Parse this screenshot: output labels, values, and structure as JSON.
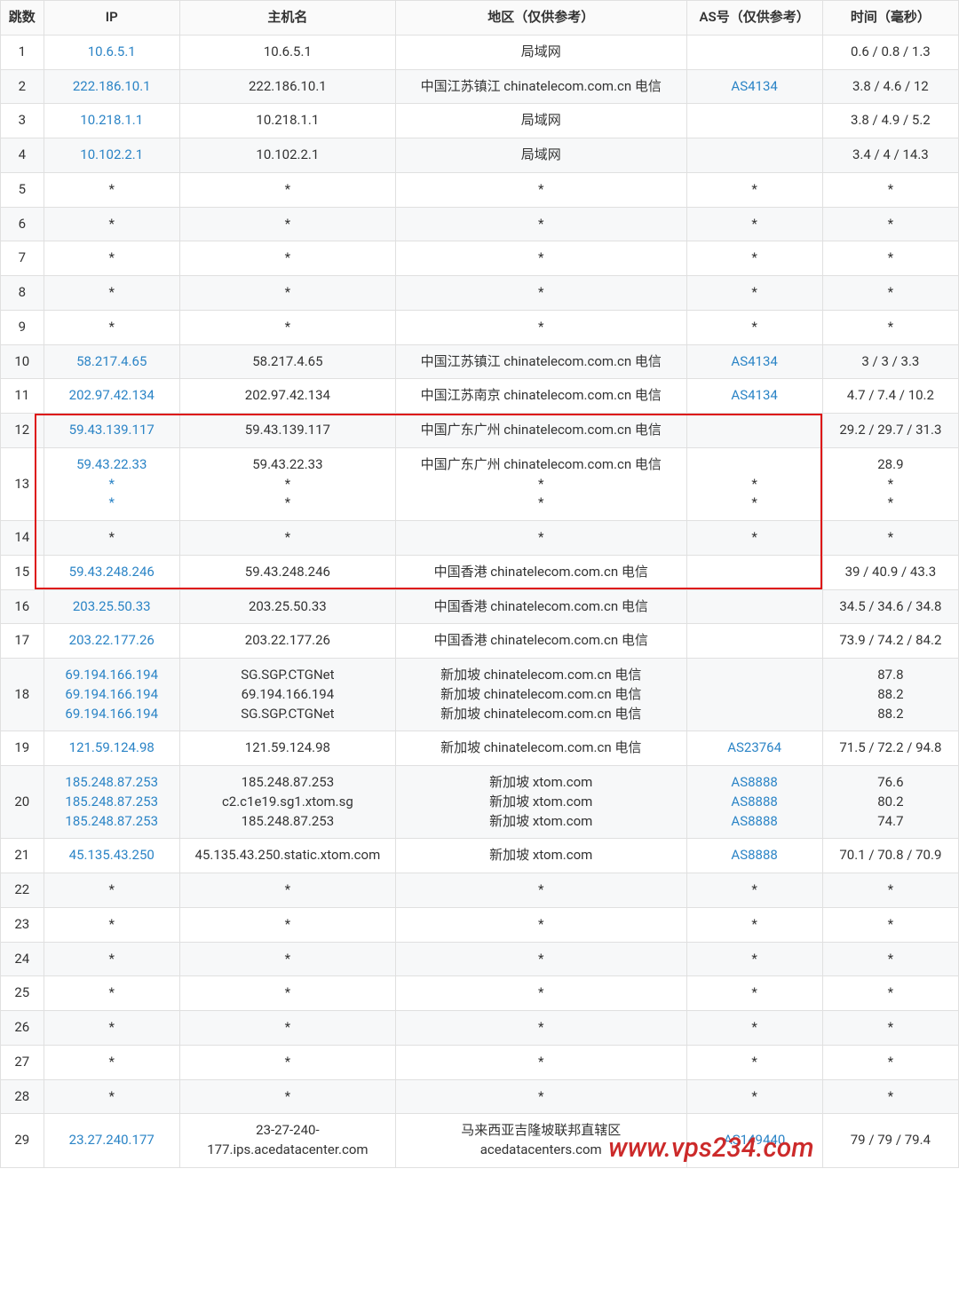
{
  "headers": {
    "hop": "跳数",
    "ip": "IP",
    "host": "主机名",
    "region": "地区（仅供参考）",
    "asn": "AS号（仅供参考）",
    "time": "时间（毫秒）"
  },
  "rows": [
    {
      "hop": "1",
      "ip": "10.6.5.1",
      "ip_link": true,
      "host": "10.6.5.1",
      "region": "局域网",
      "asn": "",
      "time": "0.6 / 0.8 / 1.3"
    },
    {
      "hop": "2",
      "ip": "222.186.10.1",
      "ip_link": true,
      "host": "222.186.10.1",
      "region": "中国江苏镇江 chinatelecom.com.cn 电信",
      "asn": "AS4134",
      "asn_link": true,
      "time": "3.8 / 4.6 / 12"
    },
    {
      "hop": "3",
      "ip": "10.218.1.1",
      "ip_link": true,
      "host": "10.218.1.1",
      "region": "局域网",
      "asn": "",
      "time": "3.8 / 4.9 / 5.2"
    },
    {
      "hop": "4",
      "ip": "10.102.2.1",
      "ip_link": true,
      "host": "10.102.2.1",
      "region": "局域网",
      "asn": "",
      "time": "3.4 / 4 / 14.3"
    },
    {
      "hop": "5",
      "ip": "*",
      "host": "*",
      "region": "*",
      "asn": "*",
      "time": "*"
    },
    {
      "hop": "6",
      "ip": "*",
      "host": "*",
      "region": "*",
      "asn": "*",
      "time": "*"
    },
    {
      "hop": "7",
      "ip": "*",
      "host": "*",
      "region": "*",
      "asn": "*",
      "time": "*"
    },
    {
      "hop": "8",
      "ip": "*",
      "host": "*",
      "region": "*",
      "asn": "*",
      "time": "*"
    },
    {
      "hop": "9",
      "ip": "*",
      "host": "*",
      "region": "*",
      "asn": "*",
      "time": "*"
    },
    {
      "hop": "10",
      "ip": "58.217.4.65",
      "ip_link": true,
      "host": "58.217.4.65",
      "region": "中国江苏镇江 chinatelecom.com.cn 电信",
      "asn": "AS4134",
      "asn_link": true,
      "time": "3 / 3 / 3.3"
    },
    {
      "hop": "11",
      "ip": "202.97.42.134",
      "ip_link": true,
      "host": "202.97.42.134",
      "region": "中国江苏南京 chinatelecom.com.cn 电信",
      "asn": "AS4134",
      "asn_link": true,
      "time": "4.7 / 7.4 / 10.2"
    },
    {
      "hop": "12",
      "ip": "59.43.139.117",
      "ip_link": true,
      "host": "59.43.139.117",
      "region": "中国广东广州 chinatelecom.com.cn 电信",
      "asn": "",
      "time": "29.2 / 29.7 / 31.3"
    },
    {
      "hop": "13",
      "ip": "59.43.22.33\n*\n*",
      "ip_link": true,
      "host": "59.43.22.33\n*\n*",
      "region": "中国广东广州 chinatelecom.com.cn 电信\n*\n*",
      "asn": "\n*\n*",
      "time": "28.9\n*\n*"
    },
    {
      "hop": "14",
      "ip": "*",
      "host": "*",
      "region": "*",
      "asn": "*",
      "time": "*"
    },
    {
      "hop": "15",
      "ip": "59.43.248.246",
      "ip_link": true,
      "host": "59.43.248.246",
      "region": "中国香港 chinatelecom.com.cn 电信",
      "asn": "",
      "time": "39 / 40.9 / 43.3"
    },
    {
      "hop": "16",
      "ip": "203.25.50.33",
      "ip_link": true,
      "host": "203.25.50.33",
      "region": "中国香港 chinatelecom.com.cn 电信",
      "asn": "",
      "time": "34.5 / 34.6 / 34.8"
    },
    {
      "hop": "17",
      "ip": "203.22.177.26",
      "ip_link": true,
      "host": "203.22.177.26",
      "region": "中国香港 chinatelecom.com.cn 电信",
      "asn": "",
      "time": "73.9 / 74.2 / 84.2"
    },
    {
      "hop": "18",
      "ip": "69.194.166.194\n69.194.166.194\n69.194.166.194",
      "ip_link": true,
      "host": "SG.SGP.CTGNet\n69.194.166.194\nSG.SGP.CTGNet",
      "region": "新加坡 chinatelecom.com.cn 电信\n新加坡 chinatelecom.com.cn 电信\n新加坡 chinatelecom.com.cn 电信",
      "asn": "",
      "time": "87.8\n88.2\n88.2"
    },
    {
      "hop": "19",
      "ip": "121.59.124.98",
      "ip_link": true,
      "host": "121.59.124.98",
      "region": "新加坡 chinatelecom.com.cn 电信",
      "asn": "AS23764",
      "asn_link": true,
      "time": "71.5 / 72.2 / 94.8"
    },
    {
      "hop": "20",
      "ip": "185.248.87.253\n185.248.87.253\n185.248.87.253",
      "ip_link": true,
      "host": "185.248.87.253\nc2.c1e19.sg1.xtom.sg\n185.248.87.253",
      "region": "新加坡 xtom.com\n新加坡 xtom.com\n新加坡 xtom.com",
      "asn": "AS8888\nAS8888\nAS8888",
      "asn_link": true,
      "time": "76.6\n80.2\n74.7"
    },
    {
      "hop": "21",
      "ip": "45.135.43.250",
      "ip_link": true,
      "host": "45.135.43.250.static.xtom.com",
      "region": "新加坡 xtom.com",
      "asn": "AS8888",
      "asn_link": true,
      "time": "70.1 / 70.8 / 70.9"
    },
    {
      "hop": "22",
      "ip": "*",
      "host": "*",
      "region": "*",
      "asn": "*",
      "time": "*"
    },
    {
      "hop": "23",
      "ip": "*",
      "host": "*",
      "region": "*",
      "asn": "*",
      "time": "*"
    },
    {
      "hop": "24",
      "ip": "*",
      "host": "*",
      "region": "*",
      "asn": "*",
      "time": "*"
    },
    {
      "hop": "25",
      "ip": "*",
      "host": "*",
      "region": "*",
      "asn": "*",
      "time": "*"
    },
    {
      "hop": "26",
      "ip": "*",
      "host": "*",
      "region": "*",
      "asn": "*",
      "time": "*"
    },
    {
      "hop": "27",
      "ip": "*",
      "host": "*",
      "region": "*",
      "asn": "*",
      "time": "*"
    },
    {
      "hop": "28",
      "ip": "*",
      "host": "*",
      "region": "*",
      "asn": "*",
      "time": "*"
    },
    {
      "hop": "29",
      "ip": "23.27.240.177",
      "ip_link": true,
      "host": "23-27-240-177.ips.acedatacenter.com",
      "region": "马来西亚吉隆坡联邦直辖区 acedatacenters.com",
      "asn": "AS149440",
      "asn_link": true,
      "time": "79 / 79 / 79.4"
    }
  ],
  "highlight": {
    "from_hop": "12",
    "to_hop": "15"
  },
  "watermark": "www.vps234.com"
}
